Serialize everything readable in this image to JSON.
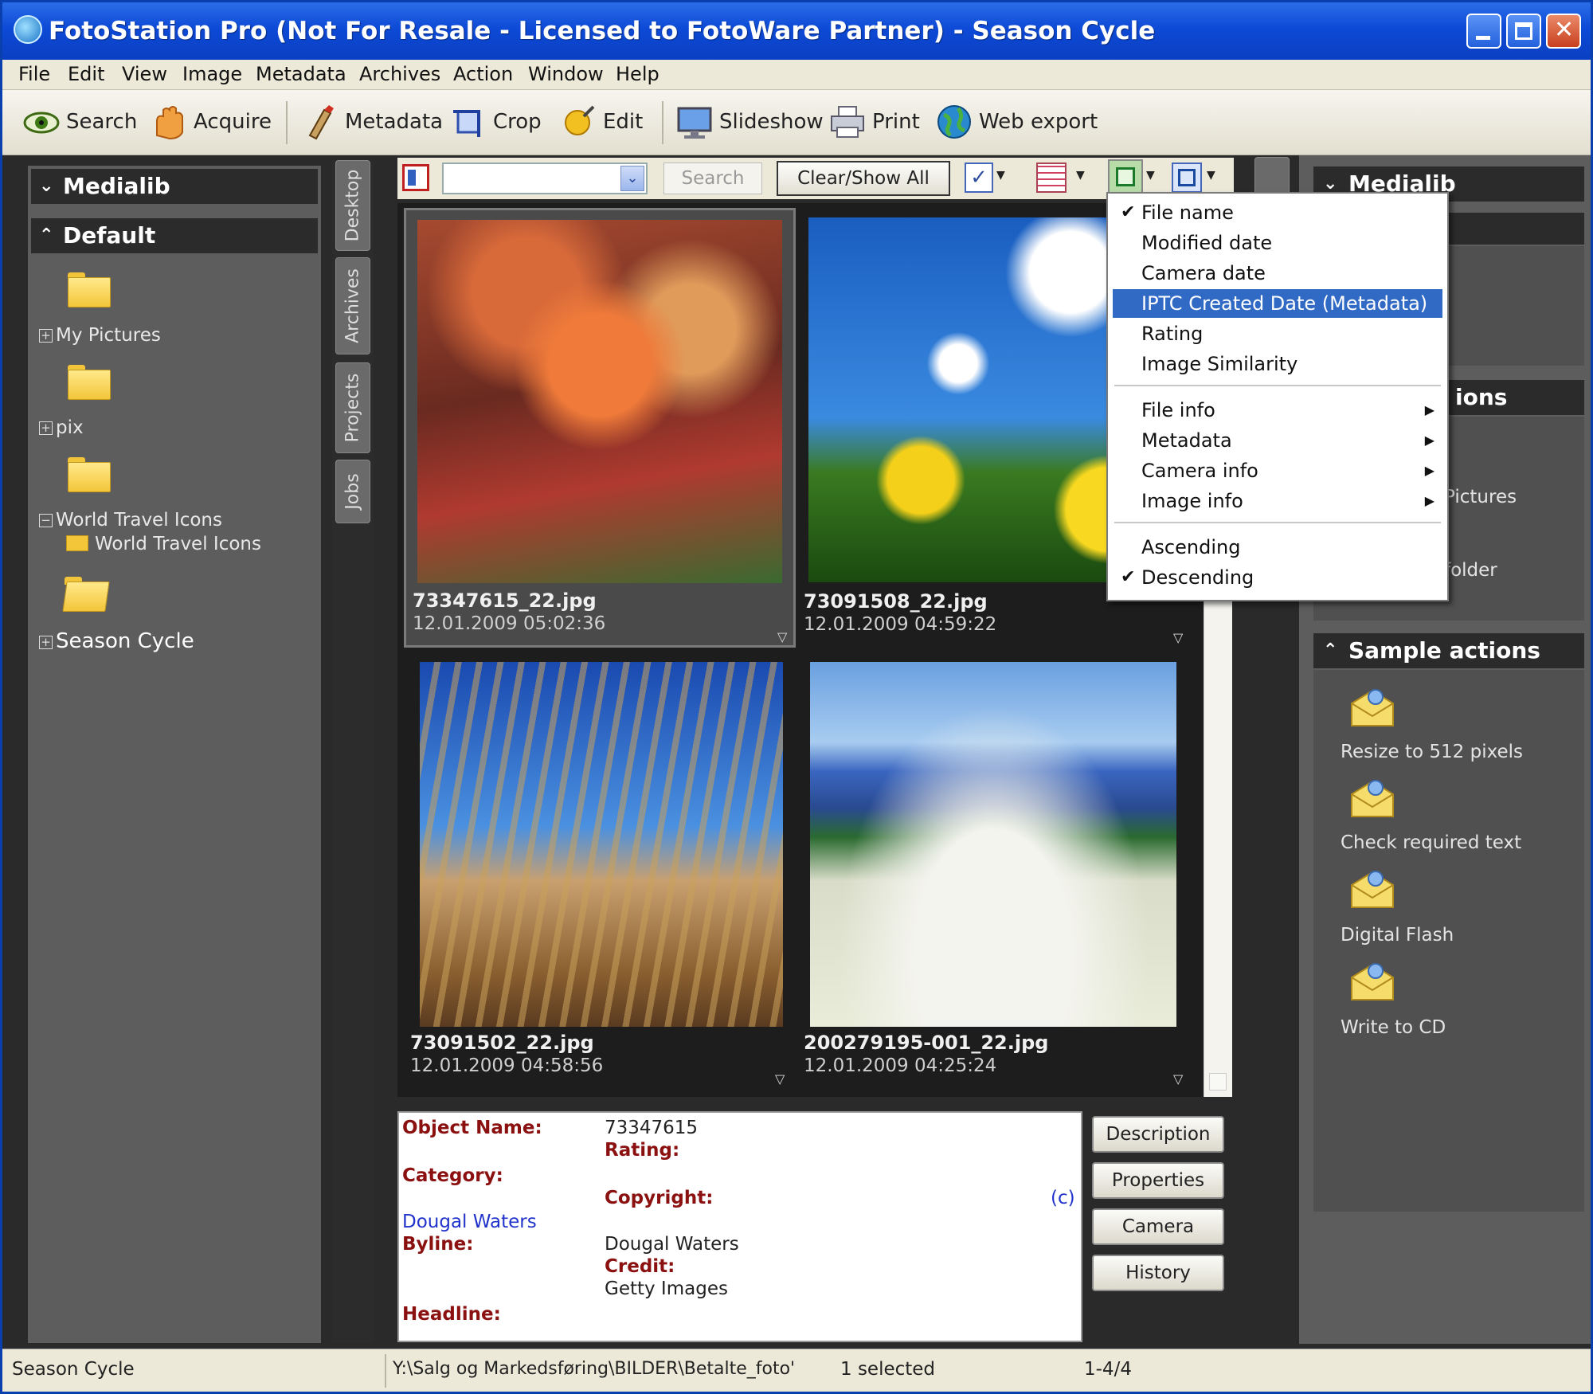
{
  "window": {
    "title": "FotoStation Pro (Not For Resale - Licensed to FotoWare Partner) - Season Cycle"
  },
  "menu": [
    "File",
    "Edit",
    "View",
    "Image",
    "Metadata",
    "Archives",
    "Action",
    "Window",
    "Help"
  ],
  "toolbar": [
    {
      "label": "Search",
      "icon": "eye-icon"
    },
    {
      "label": "Acquire",
      "icon": "hand-icon"
    },
    {
      "label": "Metadata",
      "icon": "pen-icon"
    },
    {
      "label": "Crop",
      "icon": "crop-icon"
    },
    {
      "label": "Edit",
      "icon": "edit-icon"
    },
    {
      "label": "Slideshow",
      "icon": "monitor-icon"
    },
    {
      "label": "Print",
      "icon": "printer-icon"
    },
    {
      "label": "Web export",
      "icon": "globe-icon"
    }
  ],
  "left_panel": {
    "medialib": "Medialib",
    "default": "Default",
    "folders": [
      "My Pictures",
      "pix",
      "World Travel Icons",
      "World Travel Icons",
      "Season Cycle"
    ]
  },
  "side_tabs": [
    "Desktop",
    "Archives",
    "Projects",
    "Jobs"
  ],
  "search_bar": {
    "search_button": "Search",
    "clear_button": "Clear/Show All"
  },
  "thumbnails": [
    {
      "name": "73347615_22.jpg",
      "date": "12.01.2009 05:02:36"
    },
    {
      "name": "73091508_22.jpg",
      "date": "12.01.2009 04:59:22"
    },
    {
      "name": "73091502_22.jpg",
      "date": "12.01.2009 04:58:56"
    },
    {
      "name": "200279195-001_22.jpg",
      "date": "12.01.2009 04:25:24"
    }
  ],
  "sort_menu": {
    "items": [
      "File name",
      "Modified date",
      "Camera date",
      "IPTC Created Date (Metadata)",
      "Rating",
      "Image Similarity"
    ],
    "submenus": [
      "File info",
      "Metadata",
      "Camera info",
      "Image info"
    ],
    "order": [
      "Ascending",
      "Descending"
    ]
  },
  "info": {
    "object_name_label": "Object Name:",
    "object_name": "73347615",
    "rating_label": "Rating:",
    "category_label": "Category:",
    "copyright_label": "Copyright:",
    "copyright_symbol": "(c)",
    "byline_link": "Dougal Waters",
    "byline_label": "Byline:",
    "byline_value": "Dougal Waters",
    "credit_label": "Credit:",
    "credit_value": "Getty Images",
    "headline_label": "Headline:"
  },
  "info_buttons": [
    "Description",
    "Properties",
    "Camera",
    "History"
  ],
  "right_panel": {
    "medialib": "Medialib",
    "partial_header": "ions",
    "partial_text1": "Pictures",
    "partial_text2": "folder",
    "sample_actions": "Sample actions",
    "actions": [
      "Resize to 512 pixels",
      "Check required text",
      "Digital Flash",
      "Write to CD"
    ]
  },
  "status": {
    "left": "Season Cycle",
    "path": "Y:\\Salg og Markedsføring\\BILDER\\Betalte_foto'",
    "selected": "1 selected",
    "range": "1-4/4"
  }
}
